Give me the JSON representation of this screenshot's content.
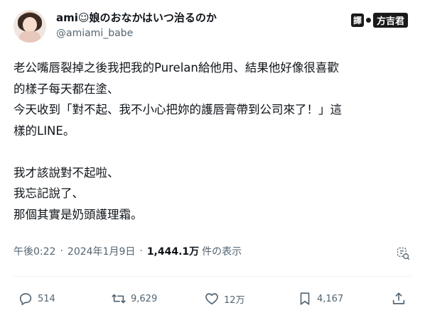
{
  "author": {
    "display_name": "ami☺娘のおなかはいつ治るのか",
    "handle": "@amiami_babe"
  },
  "watermark": {
    "badge": "譯",
    "name": "方吉君"
  },
  "tweet": {
    "lines": [
      "老公嘴唇裂掉之後我把我的Purelan給他用、結果他好像很喜歡",
      "的樣子每天都在塗、",
      "今天收到「對不起、我不小心把妳的護唇膏帶到公司來了！」這",
      "樣的LINE。",
      "",
      "我才該說對不起啦、",
      "我忘記說了、",
      "那個其實是奶頭護理霜。"
    ]
  },
  "meta": {
    "time": "午後0:22",
    "date": "2024年1月9日",
    "views_count": "1,444.1万",
    "views_label": "件の表示"
  },
  "actions": {
    "replies": "514",
    "retweets": "9,629",
    "likes": "12万",
    "bookmarks": "4,167"
  }
}
